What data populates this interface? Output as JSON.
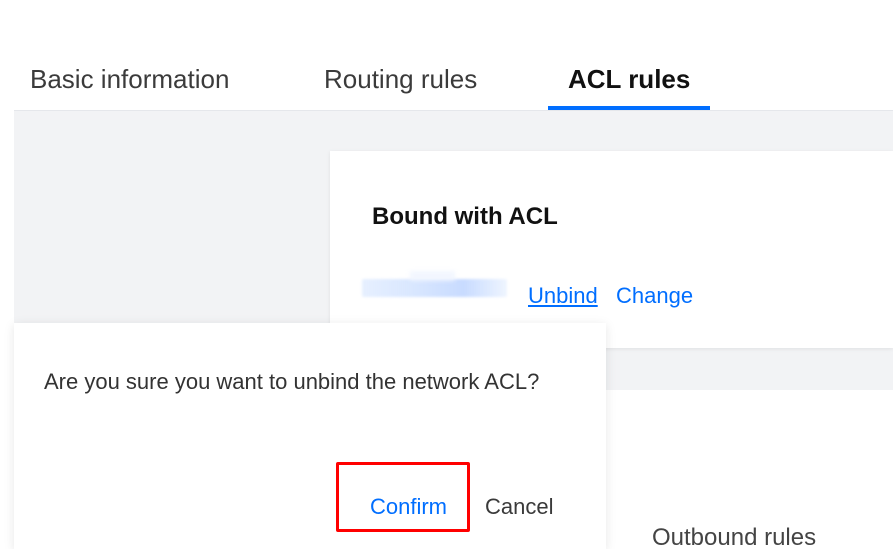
{
  "tabs": [
    {
      "label": "Basic information",
      "active": false
    },
    {
      "label": "Routing rules",
      "active": false
    },
    {
      "label": "ACL rules",
      "active": true
    }
  ],
  "acl_card": {
    "title": "Bound with ACL",
    "unbind_label": "Unbind",
    "change_label": "Change"
  },
  "outbound": {
    "label": "Outbound rules"
  },
  "popover": {
    "message": "Are you sure you want to unbind the network ACL?",
    "confirm_label": "Confirm",
    "cancel_label": "Cancel"
  },
  "colors": {
    "accent": "#006eff",
    "background": "#f2f3f5",
    "highlight": "#ff0000"
  }
}
